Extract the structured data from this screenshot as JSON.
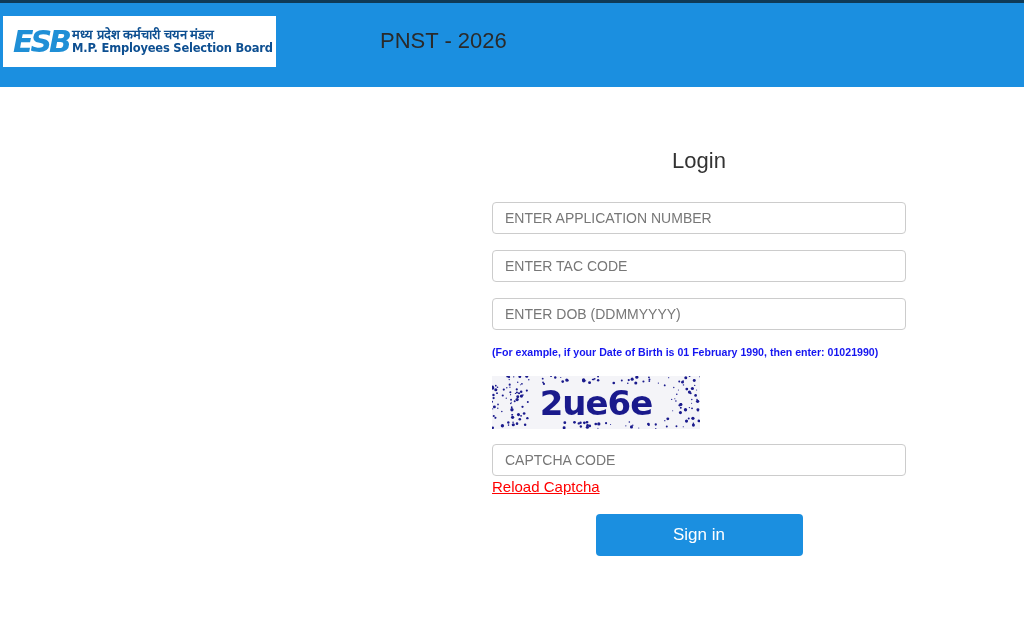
{
  "header": {
    "logo": {
      "letters": "ESB",
      "hindi_name": "मध्य प्रदेश कर्मचारी चयन मंडल",
      "english_name": "M.P. Employees Selection Board"
    },
    "title": "PNST - 2026"
  },
  "login": {
    "title": "Login",
    "fields": [
      {
        "placeholder": "ENTER APPLICATION NUMBER"
      },
      {
        "placeholder": "ENTER TAC CODE"
      },
      {
        "placeholder": "ENTER DOB (DDMMYYYY)"
      }
    ],
    "hint": "(For example, if your Date of Birth is 01 February 1990, then enter: 01021990)",
    "captcha": {
      "text": "2ue6e"
    },
    "captcha_field": {
      "placeholder": "CAPTCHA CODE"
    },
    "reload_link": "Reload Captcha",
    "submit": "Sign in"
  }
}
